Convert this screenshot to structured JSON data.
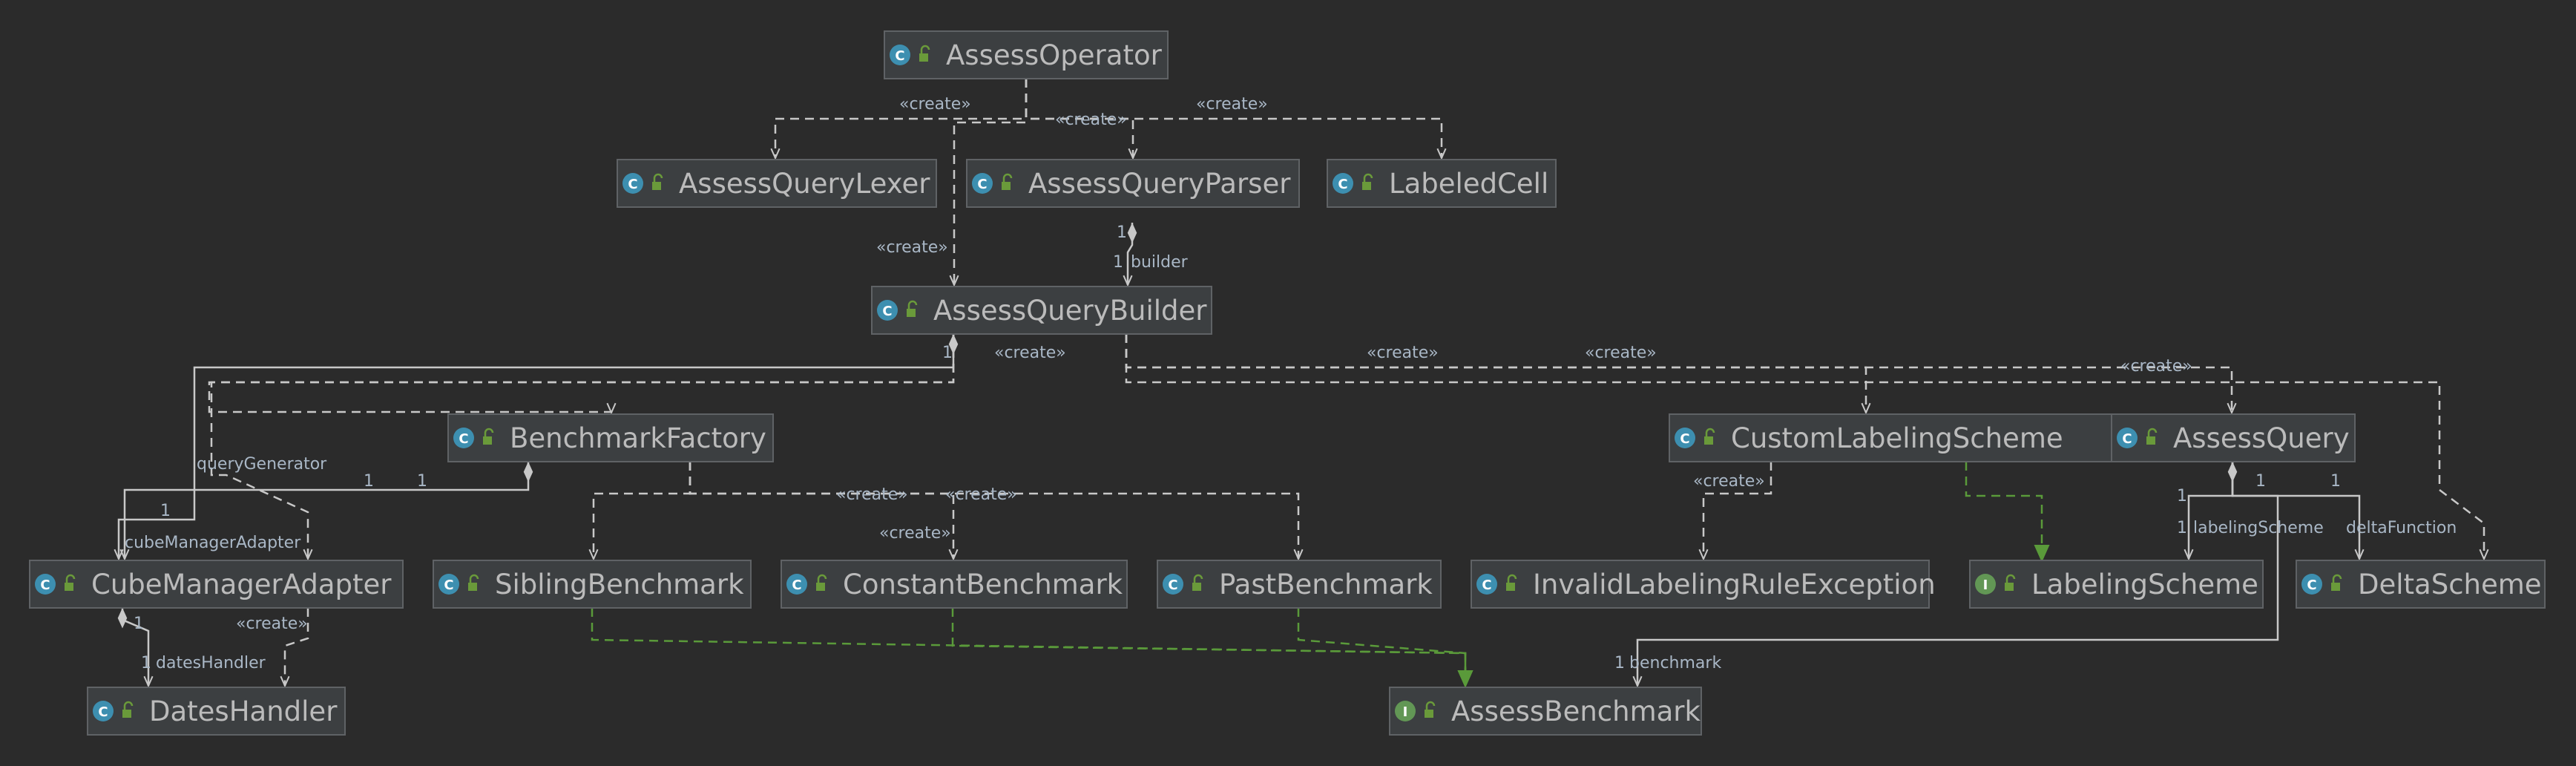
{
  "classes": [
    {
      "id": "AssessOperator",
      "kind": "class",
      "name": "AssessOperator"
    },
    {
      "id": "AssessQueryLexer",
      "kind": "class",
      "name": "AssessQueryLexer"
    },
    {
      "id": "AssessQueryParser",
      "kind": "class",
      "name": "AssessQueryParser"
    },
    {
      "id": "LabeledCell",
      "kind": "class",
      "name": "LabeledCell"
    },
    {
      "id": "AssessQueryBuilder",
      "kind": "class",
      "name": "AssessQueryBuilder"
    },
    {
      "id": "BenchmarkFactory",
      "kind": "class",
      "name": "BenchmarkFactory"
    },
    {
      "id": "CustomLabelingScheme",
      "kind": "class",
      "name": "CustomLabelingScheme"
    },
    {
      "id": "AssessQuery",
      "kind": "class",
      "name": "AssessQuery"
    },
    {
      "id": "CubeManagerAdapter",
      "kind": "class",
      "name": "CubeManagerAdapter"
    },
    {
      "id": "SiblingBenchmark",
      "kind": "class",
      "name": "SiblingBenchmark"
    },
    {
      "id": "ConstantBenchmark",
      "kind": "class",
      "name": "ConstantBenchmark"
    },
    {
      "id": "PastBenchmark",
      "kind": "class",
      "name": "PastBenchmark"
    },
    {
      "id": "InvalidLabelingRuleException",
      "kind": "class",
      "name": "InvalidLabelingRuleException"
    },
    {
      "id": "LabelingScheme",
      "kind": "interface",
      "name": "LabelingScheme"
    },
    {
      "id": "DeltaScheme",
      "kind": "class",
      "name": "DeltaScheme"
    },
    {
      "id": "DatesHandler",
      "kind": "class",
      "name": "DatesHandler"
    },
    {
      "id": "AssessBenchmark",
      "kind": "interface",
      "name": "AssessBenchmark"
    }
  ],
  "kind_glyphs": {
    "class": "C",
    "interface": "I"
  },
  "colors": {
    "class_badge": "#3d8fb0",
    "interface_badge": "#629755",
    "lock": "#6a9a3a",
    "implements": "#5a9a3a",
    "dependency": "#c8c8c8"
  },
  "relations": [
    {
      "type": "create",
      "from": "AssessOperator",
      "to": "AssessQueryLexer",
      "label": "«create»"
    },
    {
      "type": "create",
      "from": "AssessOperator",
      "to": "AssessQueryParser",
      "label": "«create»"
    },
    {
      "type": "create",
      "from": "AssessOperator",
      "to": "LabeledCell",
      "label": "«create»"
    },
    {
      "type": "create",
      "from": "AssessOperator",
      "to": "AssessQueryBuilder",
      "label": "«create»"
    },
    {
      "type": "composition",
      "from": "AssessQueryParser",
      "to": "AssessQueryBuilder",
      "mult_from": "1",
      "mult_to": "1",
      "role": "builder"
    },
    {
      "type": "create",
      "from": "AssessQueryBuilder",
      "to": "BenchmarkFactory",
      "label": "«create»"
    },
    {
      "type": "create",
      "from": "AssessQueryBuilder",
      "to": "CustomLabelingScheme",
      "label": "«create»"
    },
    {
      "type": "create",
      "from": "AssessQueryBuilder",
      "to": "AssessQuery",
      "label": "«create»"
    },
    {
      "type": "create",
      "from": "AssessQueryBuilder",
      "to": "DeltaScheme",
      "label": "«create»"
    },
    {
      "type": "create",
      "from": "AssessQueryBuilder",
      "to": "CubeManagerAdapter",
      "label": "«create»"
    },
    {
      "type": "composition",
      "from": "AssessQueryBuilder",
      "to": "CubeManagerAdapter",
      "mult_from": "1",
      "mult_to": "1",
      "role": "queryGenerator"
    },
    {
      "type": "composition",
      "from": "BenchmarkFactory",
      "to": "CubeManagerAdapter",
      "mult_from": "1",
      "mult_to": "1",
      "role": "cubeManagerAdapter"
    },
    {
      "type": "create",
      "from": "BenchmarkFactory",
      "to": "SiblingBenchmark",
      "label": "«create»"
    },
    {
      "type": "create",
      "from": "BenchmarkFactory",
      "to": "ConstantBenchmark",
      "label": "«create»"
    },
    {
      "type": "create",
      "from": "BenchmarkFactory",
      "to": "PastBenchmark",
      "label": "«create»"
    },
    {
      "type": "create",
      "from": "CustomLabelingScheme",
      "to": "InvalidLabelingRuleException",
      "label": "«create»"
    },
    {
      "type": "implements",
      "from": "CustomLabelingScheme",
      "to": "LabelingScheme"
    },
    {
      "type": "composition",
      "from": "AssessQuery",
      "to": "LabelingScheme",
      "mult_from": "1",
      "mult_to": "1",
      "role": "labelingScheme"
    },
    {
      "type": "composition",
      "from": "AssessQuery",
      "to": "DeltaScheme",
      "mult_from": "1",
      "mult_to": "1",
      "role": "deltaFunction"
    },
    {
      "type": "composition",
      "from": "AssessQuery",
      "to": "AssessBenchmark",
      "mult_from": "1",
      "mult_to": "1",
      "role": "benchmark"
    },
    {
      "type": "composition",
      "from": "CubeManagerAdapter",
      "to": "DatesHandler",
      "mult_from": "1",
      "mult_to": "1",
      "role": "datesHandler"
    },
    {
      "type": "create",
      "from": "CubeManagerAdapter",
      "to": "DatesHandler",
      "label": "«create»"
    },
    {
      "type": "implements",
      "from": "SiblingBenchmark",
      "to": "AssessBenchmark"
    },
    {
      "type": "implements",
      "from": "ConstantBenchmark",
      "to": "AssessBenchmark"
    },
    {
      "type": "implements",
      "from": "PastBenchmark",
      "to": "AssessBenchmark"
    }
  ]
}
